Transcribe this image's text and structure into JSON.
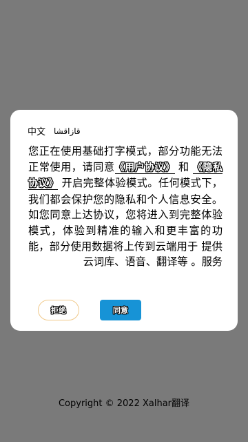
{
  "dialog": {
    "languages": [
      "中文",
      "قازاقشا"
    ],
    "text_before_user": "您正在使用基础打字模式，部分功能无法正常使用，请同意",
    "user_agreement": "《用户协议》",
    "and": "和",
    "privacy_policy": "《隐私协议》",
    "text_after": "开启完整体验模式。任何模式下，我们都会保护您的隐私和个人信息安全。如您同意上达协议，您将进入到完整体验模式，体验到精准的输入和更丰富的功能，部分使用数据将上传到云端用于 提供云词库、语音、翻译等 。服务",
    "reject_label": "拒绝",
    "agree_label": "同意"
  },
  "footer": {
    "copyright": "Copyright © 2022 Xalhar翻译"
  },
  "colors": {
    "backdrop": "#7a7a7a",
    "agree_button": "#1793d6",
    "reject_border": "#f0c98a"
  }
}
